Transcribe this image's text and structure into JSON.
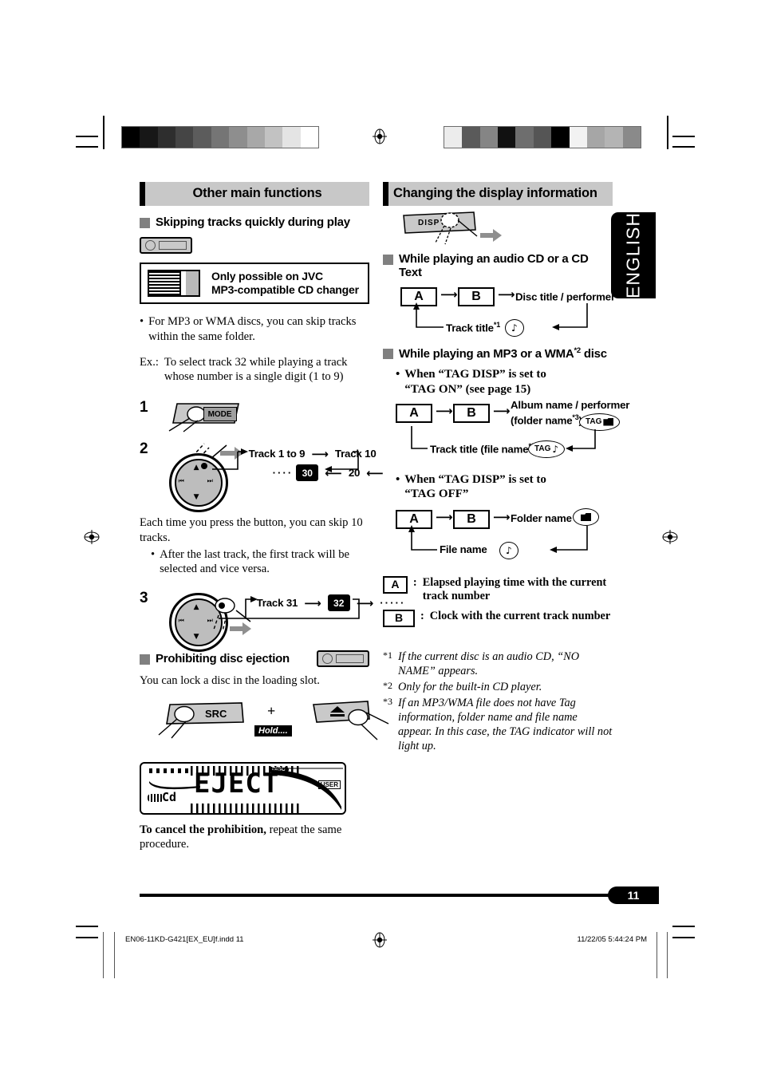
{
  "sidetab": {
    "language": "ENGLISH"
  },
  "left": {
    "section_title": "Other main functions",
    "sub1_title": "Skipping tracks quickly during play",
    "changer_note_line1": "Only possible on JVC",
    "changer_note_line2": "MP3-compatible CD changer",
    "bullet1": "For MP3 or WMA discs, you can skip tracks within the same folder.",
    "ex_label": "Ex.:",
    "ex_text": "To select track 32 while playing a track whose number is a single digit (1 to 9)",
    "step1_num": "1",
    "step1_key": "MODE",
    "step2_num": "2",
    "step2_flow_a": "Track 1 to 9",
    "step2_flow_b": "Track 10",
    "step2_flow_dots": "····",
    "step2_flow_c": "30",
    "step2_flow_d": "20",
    "step2_text": "Each time you press the button, you can skip 10 tracks.",
    "step2_bullet": "After the last track, the first track will be selected and vice versa.",
    "step3_num": "3",
    "step3_flow_a": "Track 31",
    "step3_flow_b": "32",
    "step3_flow_dots": "·····",
    "sub2_title": "Prohibiting disc ejection",
    "sub2_text": "You can lock a disc in the loading slot.",
    "key_src": "SRC",
    "plus": "+",
    "hold": "Hold....",
    "lcd": {
      "main": "EJECT",
      "disc": "DISC",
      "cd": "Cd",
      "user": "USER"
    },
    "cancel_bold": "To cancel the prohibition,",
    "cancel_rest": " repeat the same procedure."
  },
  "right": {
    "section_title": "Changing the display information",
    "key_disp": "DISP",
    "sub1_title_pre": "While playing an audio CD or a CD Text",
    "cd_flow": {
      "a": "A",
      "b": "B",
      "label1": "Disc title / performer",
      "label1_sup": "*1",
      "label2": "Track title",
      "label2_sup": "*1",
      "note_icon": "♪"
    },
    "sub2_title": "While playing an MP3 or a WMA",
    "sub2_title_sup": "*2",
    "sub2_title_tail": " disc",
    "tag_on_line1": "When “TAG DISP” is set to",
    "tag_on_line2": "“TAG ON” (see page 15)",
    "tag_on_flow": {
      "a": "A",
      "b": "B",
      "label1_line1": "Album name / performer",
      "label1_line2": "(folder name",
      "label1_sup": "*3",
      "label1_tail": ")",
      "tag_folder": "TAG",
      "label2": "Track title (file name",
      "label2_sup": "*3",
      "label2_tail": ")",
      "tag_note": "TAG"
    },
    "tag_off_line1": "When “TAG DISP” is set to",
    "tag_off_line2": "“TAG OFF”",
    "tag_off_flow": {
      "a": "A",
      "b": "B",
      "label1": "Folder name",
      "label2": "File name"
    },
    "legend": [
      {
        "box": "A",
        "colon": ":",
        "text": "Elapsed playing time with the current track number"
      },
      {
        "box": "B",
        "colon": ":",
        "text": "Clock with the current track number"
      }
    ],
    "footnotes": [
      {
        "mark": "*1",
        "text": "If the current disc is an audio CD, “NO NAME” appears."
      },
      {
        "mark": "*2",
        "text": "Only for the built-in CD player."
      },
      {
        "mark": "*3",
        "text": "If an MP3/WMA file does not have Tag information, folder name and file name appear. In this case, the TAG indicator will not light up."
      }
    ]
  },
  "footer": {
    "page_number": "11",
    "file_name": "EN06-11KD-G421[EX_EU]f.indd   11",
    "timestamp": "11/22/05   5:44:24 PM"
  },
  "calibration": {
    "bar_left": [
      "#000000",
      "#171717",
      "#2e2e2e",
      "#454545",
      "#5c5c5c",
      "#757575",
      "#8e8e8e",
      "#a8a8a8",
      "#c2c2c2",
      "#e4e4e4",
      "#ffffff"
    ],
    "bar_right": [
      "#ececec",
      "#5a5a5a",
      "#858585",
      "#111111",
      "#6e6e6e",
      "#555555",
      "#000000",
      "#f2f2f2",
      "#a6a6a6",
      "#b4b4b4",
      "#8a8a8a"
    ]
  }
}
